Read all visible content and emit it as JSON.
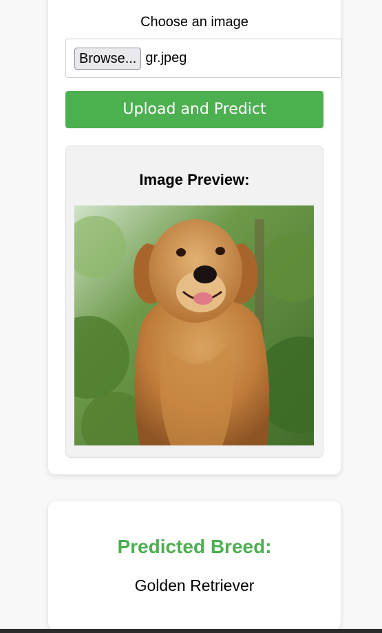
{
  "upload": {
    "label": "Choose an image",
    "browse_label": "Browse...",
    "file_name": "gr.jpeg",
    "submit_label": "Upload and Predict"
  },
  "preview": {
    "title": "Image Preview:"
  },
  "result": {
    "heading": "Predicted Breed:",
    "breed": "Golden Retriever"
  },
  "colors": {
    "accent": "#4caf50",
    "background": "#f8f8f8",
    "card": "#ffffff",
    "preview_bg": "#f2f2f2"
  }
}
